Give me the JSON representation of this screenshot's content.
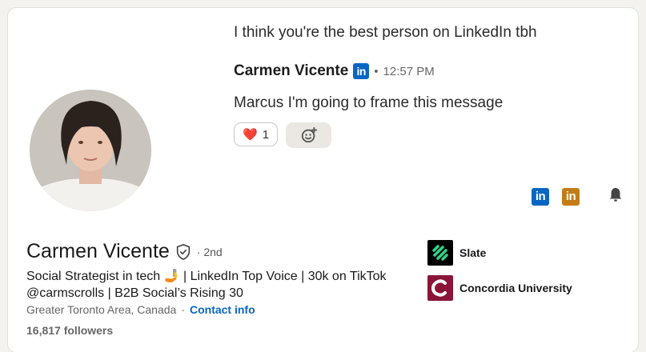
{
  "messages": {
    "prev_text": "I think you're the best person on LinkedIn tbh",
    "sender_name": "Carmen Vicente",
    "sender_badge": "in",
    "separator": "•",
    "time": "12:57 PM",
    "text": "Marcus I'm going to frame this message",
    "reaction": {
      "emoji": "❤️",
      "count": "1"
    }
  },
  "profile": {
    "name": "Carmen Vicente",
    "degree": "· 2nd",
    "headline": "Social Strategist in tech 🤳 | LinkedIn Top Voice | 30k on TikTok @carmscrolls | B2B Social’s Rising 30",
    "location": "Greater Toronto Area, Canada",
    "location_sep": "·",
    "contact_link": "Contact info",
    "followers": "16,817 followers"
  },
  "experience": [
    {
      "name": "Slate",
      "logo_bg": "#000000",
      "logo_fg": "#2fd48a"
    },
    {
      "name": "Concordia University",
      "logo_bg": "#8a1538",
      "logo_fg": "#ffffff"
    }
  ],
  "actions": {
    "linkedin_blue_label": "in",
    "linkedin_gold_label": "in",
    "colors": {
      "linkedin_blue": "#0a66c2",
      "linkedin_gold": "#c37d16",
      "bell": "#444444"
    }
  }
}
